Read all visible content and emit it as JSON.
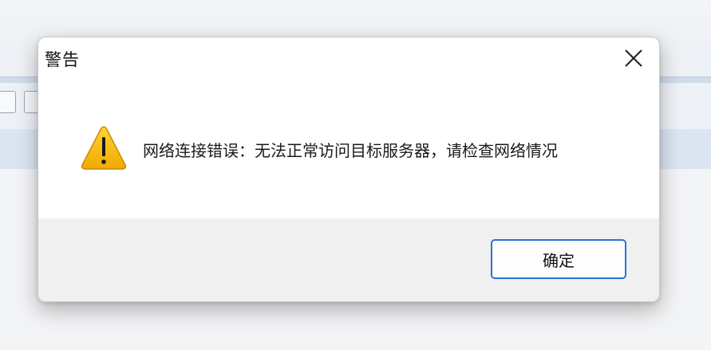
{
  "dialog": {
    "title": "警告",
    "message": "网络连接错误：无法正常访问目标服务器，请检查网络情况",
    "ok_label": "确定",
    "icon": "warning-icon",
    "close_icon": "close-icon"
  },
  "colors": {
    "accent": "#2d6fd6",
    "warning_fill": "#f7b500",
    "footer_bg": "#f0f0f0"
  }
}
